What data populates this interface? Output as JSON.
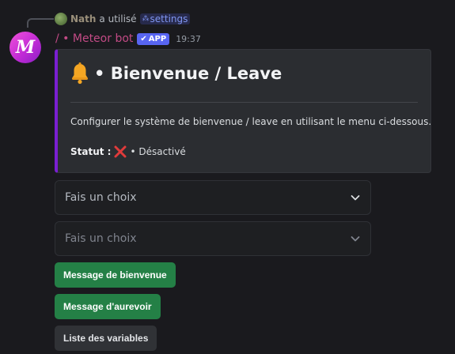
{
  "reply": {
    "user": "Nath",
    "action": "a utilisé",
    "command": "settings"
  },
  "message": {
    "bot_name": "/ • Meteor bot",
    "badge": "APP",
    "time": "19:37",
    "avatar_letter": "M"
  },
  "embed": {
    "accent_color": "#7a1fd1",
    "title": "• Bienvenue / Leave",
    "description": "Configurer le système de bienvenue / leave en utilisant le menu ci-dessous.",
    "status_label": "Statut :",
    "status_value": "• Désactivé"
  },
  "selects": [
    {
      "placeholder": "Fais un choix"
    },
    {
      "placeholder": "Fais un choix"
    }
  ],
  "buttons": [
    {
      "label": "Message de bienvenue",
      "color": "#248046"
    },
    {
      "label": "Message d'aurevoir",
      "color": "#248046"
    },
    {
      "label": "Liste des variables",
      "color": "#303236"
    }
  ],
  "icons": {
    "reply_avatar": "user-avatar-icon",
    "command": "slash-command-icon",
    "badge_check": "check-icon",
    "title": "bell-icon",
    "status": "cross-mark-icon",
    "select": "chevron-down-icon"
  }
}
